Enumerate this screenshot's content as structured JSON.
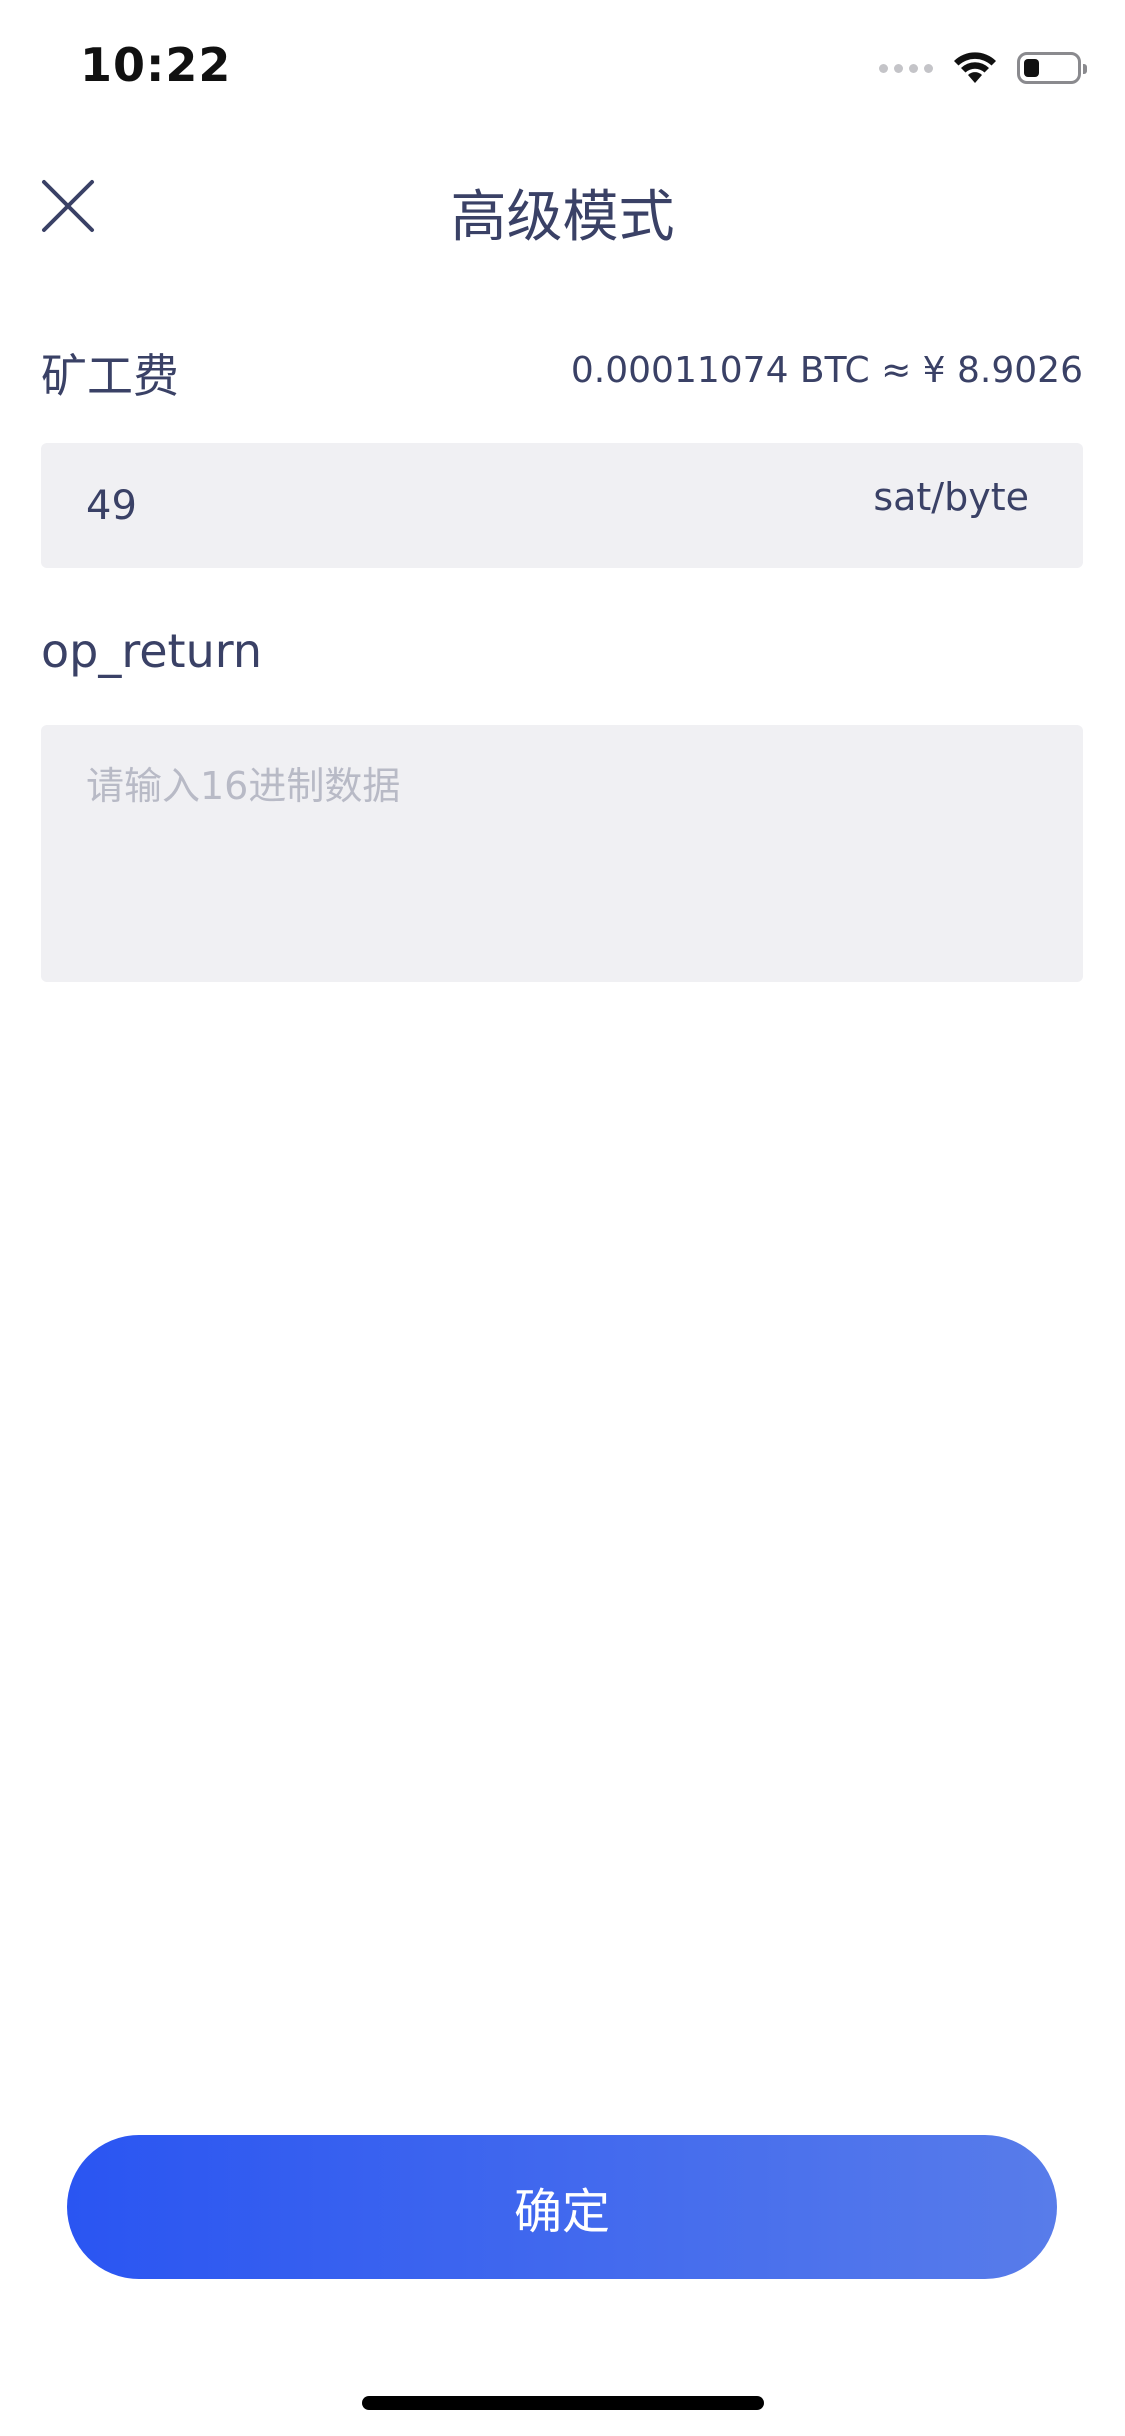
{
  "status_bar": {
    "time": "10:22",
    "battery_level": 0.3
  },
  "nav": {
    "title": "高级模式",
    "close_icon": "close-icon"
  },
  "fee": {
    "label": "矿工费",
    "value": "0.00011074 BTC ≈ ¥ 8.9026",
    "input_value": "49",
    "unit": "sat/byte"
  },
  "op_return": {
    "label": "op_return",
    "placeholder": "请输入16进制数据",
    "value": ""
  },
  "confirm": {
    "label": "确定"
  },
  "colors": {
    "text": "#3a4166",
    "input_bg": "#f0f0f3",
    "placeholder": "#b8bac6",
    "button_start": "#2a55f2",
    "button_end": "#587cea"
  }
}
